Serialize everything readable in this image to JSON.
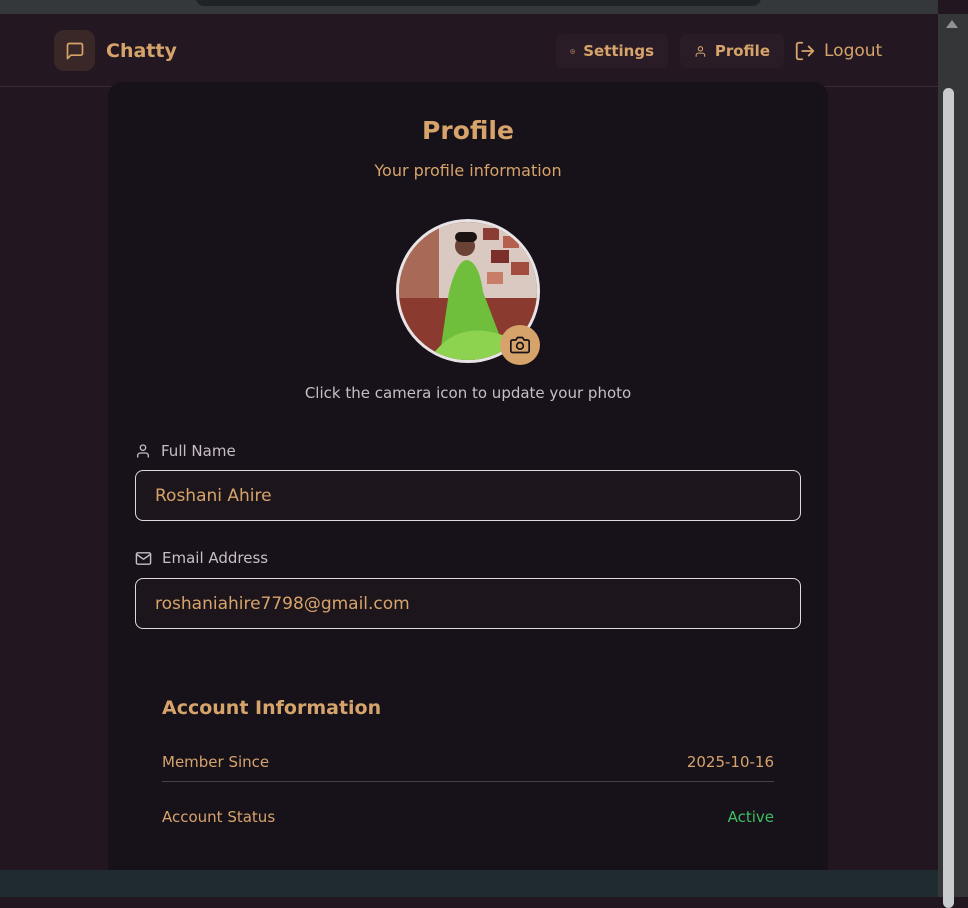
{
  "app": {
    "name": "Chatty"
  },
  "nav": {
    "settings_label": "Settings",
    "profile_label": "Profile",
    "logout_label": "Logout"
  },
  "profile": {
    "title": "Profile",
    "subtitle": "Your profile information",
    "photo_hint": "Click the camera icon to update your photo"
  },
  "fields": {
    "full_name_label": "Full Name",
    "full_name_value": "Roshani Ahire",
    "email_label": "Email Address",
    "email_value": "roshaniahire7798@gmail.com"
  },
  "account": {
    "title": "Account Information",
    "member_since_label": "Member Since",
    "member_since_value": "2025-10-16",
    "status_label": "Account Status",
    "status_value": "Active"
  },
  "colors": {
    "accent": "#d6a46b",
    "background": "#221720",
    "card": "#17111a",
    "status_active": "#3fbd62"
  },
  "icons": {
    "logo": "message-square-icon",
    "settings": "gear-icon",
    "profile": "user-icon",
    "logout": "logout-icon",
    "camera": "camera-icon",
    "name": "user-icon",
    "email": "mail-icon"
  }
}
